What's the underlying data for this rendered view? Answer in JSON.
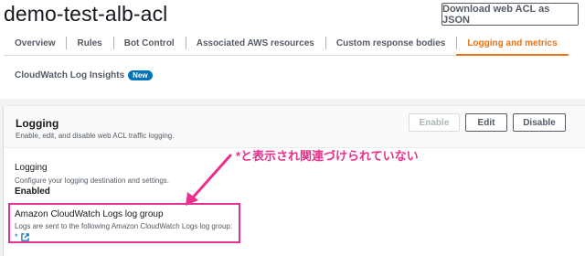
{
  "header": {
    "title": "demo-test-alb-acl",
    "download_label": "Download web ACL as JSON"
  },
  "tabs": [
    {
      "label": "Overview"
    },
    {
      "label": "Rules"
    },
    {
      "label": "Bot Control"
    },
    {
      "label": "Associated AWS resources"
    },
    {
      "label": "Custom response bodies"
    },
    {
      "label": "Logging and metrics",
      "active": true
    }
  ],
  "subtab": {
    "label": "CloudWatch Log Insights",
    "badge": "New"
  },
  "logging_panel": {
    "title": "Logging",
    "description": "Enable, edit, and disable web ACL traffic logging.",
    "enable_label": "Enable",
    "edit_label": "Edit",
    "disable_label": "Disable",
    "logging_field": {
      "label": "Logging",
      "description": "Configure your logging destination and settings.",
      "value": "Enabled"
    },
    "log_group_field": {
      "label": "Amazon CloudWatch Logs log group",
      "description": "Logs are sent to the following Amazon CloudWatch Logs log group:",
      "value": "*"
    }
  },
  "annotation": {
    "text": "*と表示され関連づけられていない",
    "color": "#e8308c"
  },
  "colors": {
    "accent": "#ec7211",
    "link": "#0073bb",
    "annotation": "#e8308c"
  }
}
